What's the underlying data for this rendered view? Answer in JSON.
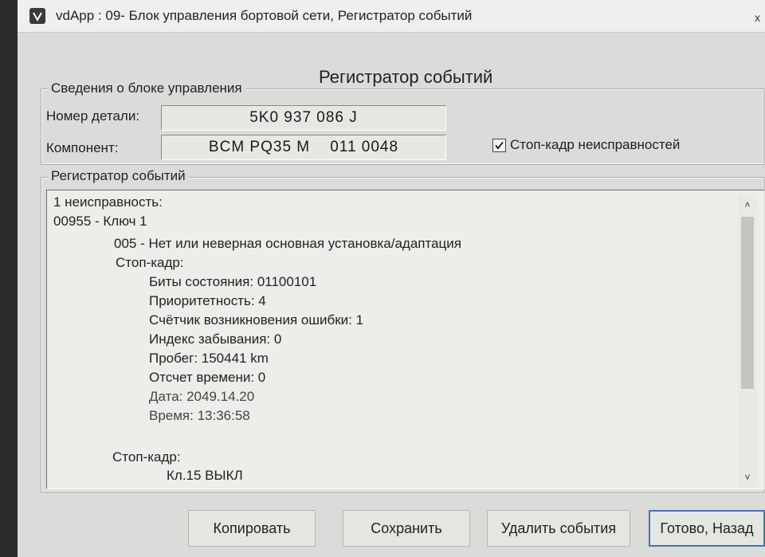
{
  "window": {
    "title": "vdApp : 09- Блок управления бортовой сети,  Регистратор событий",
    "close_glyph": "x"
  },
  "heading": "Регистратор событий",
  "control_unit": {
    "group_title": "Сведения о блоке управления",
    "part_number_label": "Номер детали:",
    "part_number_value": "5K0 937 086 J",
    "component_label": "Компонент:",
    "component_value": "BCM PQ35 M    011 0048",
    "freeze_frame_checkbox_label": "Стоп-кадр неисправностей",
    "freeze_frame_checked": true
  },
  "event_log": {
    "group_title": "Регистратор событий",
    "lines": [
      "1 неисправность:",
      "00955 - Ключ 1",
      "005 - Нет или неверная основная установка/адаптация",
      "Стоп-кадр:",
      "Биты состояния: 01100101",
      "Приоритетность: 4",
      "Счётчик возникновения ошибки: 1",
      "Индекс забывания: 0",
      "Пробег: 150441 km",
      "Отсчет времени: 0",
      "Дата: 2049.14.20",
      "Время: 13:36:58",
      "Стоп-кадр:",
      "Кл.15 ВЫКЛ"
    ]
  },
  "scrollbar": {
    "up_glyph": "˄",
    "down_glyph": "˅"
  },
  "buttons": {
    "copy": "Копировать",
    "save": "Сохранить",
    "delete_events": "Удалить события",
    "done_back": "Готово, Назад"
  },
  "colors": {
    "window_bg": "#d9dcd8",
    "log_bg": "#eceeea",
    "default_button_border": "#4b72b0"
  }
}
